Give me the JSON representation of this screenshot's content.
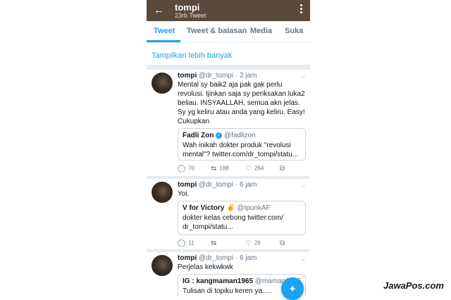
{
  "header": {
    "title": "tompi",
    "subtitle": "23rb Tweet"
  },
  "tabs": [
    {
      "label": "Tweet",
      "active": true
    },
    {
      "label": "Tweet & balasan",
      "active": false
    },
    {
      "label": "Media",
      "active": false
    },
    {
      "label": "Suka",
      "active": false
    }
  ],
  "show_more": "Tampilkan lebih banyak",
  "tweets": [
    {
      "name": "tompi",
      "handle": "@dr_tompi",
      "time": "· 2 jam",
      "text": "Mental sy baik2 aja pak gak perlu revolusi. Ijinkan saja sy periksakan luka2 beliau. INSYAALLAH, semua akn jelas. Sy yg keliru atau anda yang keliru. Easy! Cukupkan",
      "quote": {
        "name": "Fadli Zon",
        "handle": "@fadlizon",
        "text": "Wah inikah dokter produk \"revolusi mental\"? twitter.com/dr_tompi/statu..."
      },
      "replies": "70",
      "retweets": "188",
      "likes": "264"
    },
    {
      "name": "tompi",
      "handle": "@dr_tompi",
      "time": "· 6 jam",
      "text": "Yoi.",
      "quote": {
        "name": "V for Victory ✌",
        "handle": "@IpunkAF",
        "text": "dokter kelas cebong twitter.com/ dr_tompi/statu..."
      },
      "replies": "11",
      "retweets": "",
      "likes": "26"
    },
    {
      "name": "tompi",
      "handle": "@dr_tompi",
      "time": "· 6 jam",
      "text": "Perjelas kekwkwk",
      "quote": {
        "name": "IG : kangmaman1965",
        "handle": "@maman1965",
        "text": "Tulisan di topiku keren ya....."
      }
    }
  ],
  "icons": {
    "back": "arrow-left-icon",
    "menu": "kebab-icon",
    "reply": "reply-icon",
    "retweet": "retweet-icon",
    "like": "heart-icon",
    "share": "share-icon",
    "compose": "compose-icon"
  },
  "colors": {
    "header_bg": "#5a4a3b",
    "accent": "#1da1f2"
  },
  "watermark": "JawaPos.com"
}
